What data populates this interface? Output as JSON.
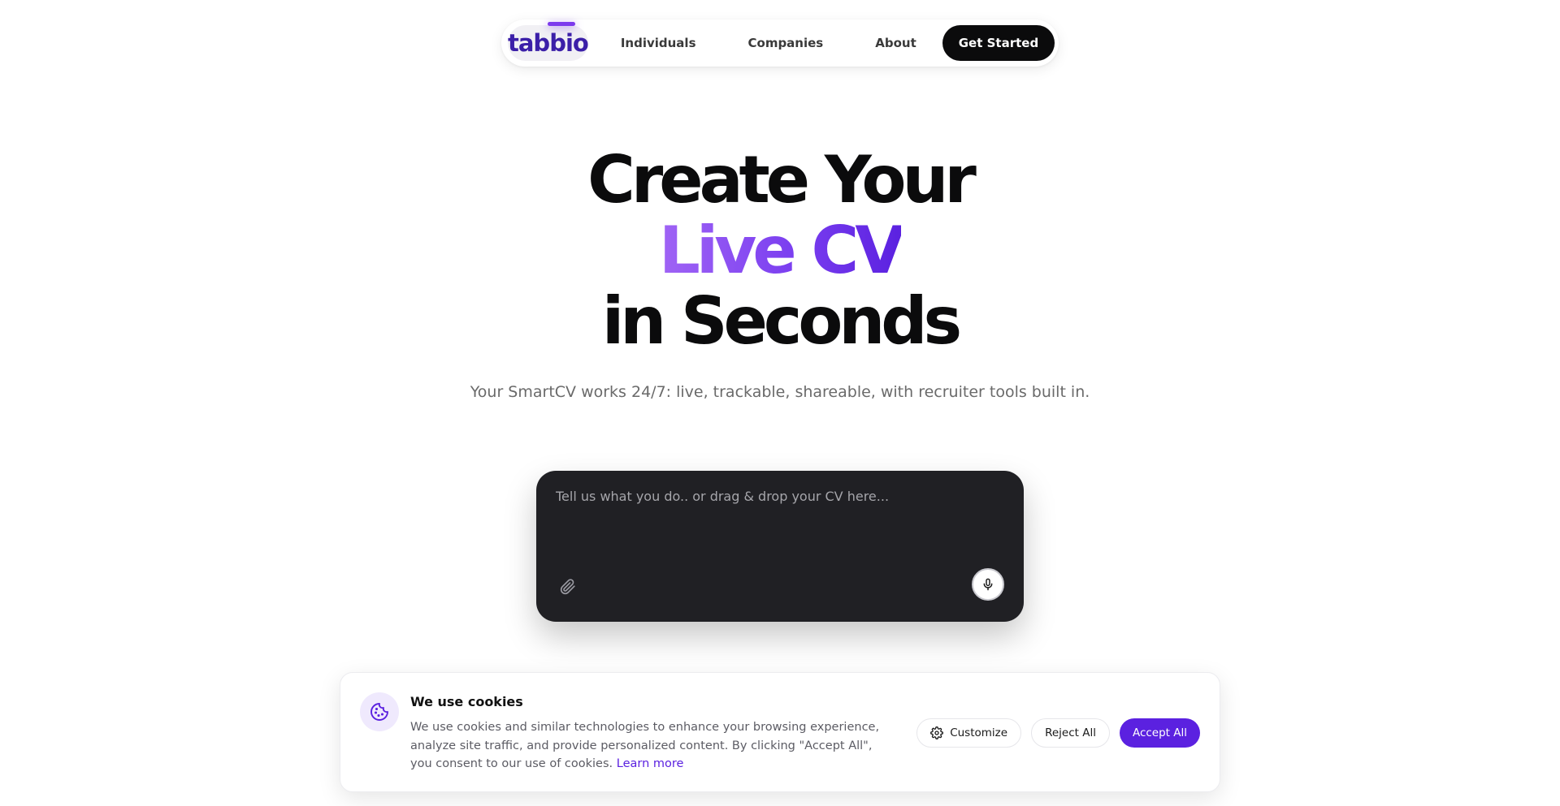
{
  "nav": {
    "logo": "tabbio",
    "links": [
      "Individuals",
      "Companies",
      "About"
    ],
    "cta": "Get Started"
  },
  "hero": {
    "line1": "Create Your",
    "line2": "Live CV",
    "line3": "in Seconds",
    "subtitle": "Your SmartCV works 24/7: live, trackable, shareable, with recruiter tools built in."
  },
  "prompt": {
    "placeholder": "Tell us what you do.. or drag & drop your CV here..."
  },
  "cookies": {
    "title": "We use cookies",
    "body": "We use cookies and similar technologies to enhance your browsing experience, analyze site traffic, and provide personalized content. By clicking \"Accept All\", you consent to our use of cookies.",
    "learn_more": "Learn more",
    "customize": "Customize",
    "reject": "Reject All",
    "accept": "Accept All"
  },
  "colors": {
    "accent": "#5b21e0",
    "gradient_start": "#a064f5",
    "gradient_end": "#5b21e0",
    "prompt_bg": "#202024"
  },
  "icons": [
    "paperclip-icon",
    "microphone-icon",
    "cookie-icon",
    "gear-icon"
  ]
}
